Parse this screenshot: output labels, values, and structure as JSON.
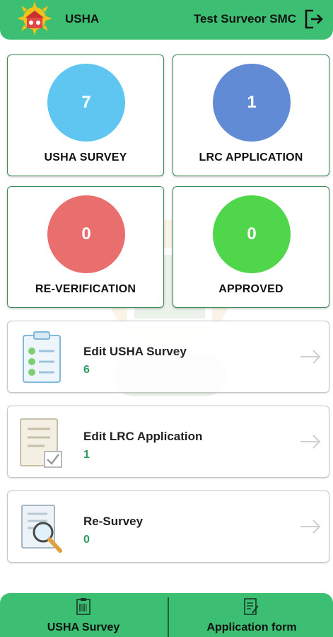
{
  "header": {
    "app_title": "USHA",
    "user_name": "Test Surveor SMC"
  },
  "stats": [
    {
      "label": "USHA SURVEY",
      "value": "7",
      "color": "#5ec6f1"
    },
    {
      "label": "LRC APPLICATION",
      "value": "1",
      "color": "#628bd6"
    },
    {
      "label": "RE-VERIFICATION",
      "value": "0",
      "color": "#e96f6f"
    },
    {
      "label": "APPROVED",
      "value": "0",
      "color": "#4fd64b"
    }
  ],
  "actions": [
    {
      "title": "Edit USHA Survey",
      "count": "6",
      "icon": "clipboard-checklist-icon"
    },
    {
      "title": "Edit LRC Application",
      "count": "1",
      "icon": "document-check-icon"
    },
    {
      "title": "Re-Survey",
      "count": "0",
      "icon": "document-search-icon"
    }
  ],
  "bottom_nav": [
    {
      "label": "USHA Survey",
      "icon": "survey-form-icon"
    },
    {
      "label": "Application form",
      "icon": "application-form-icon"
    }
  ],
  "colors": {
    "brand_green": "#3dbf73",
    "count_green": "#2e9b5d"
  }
}
